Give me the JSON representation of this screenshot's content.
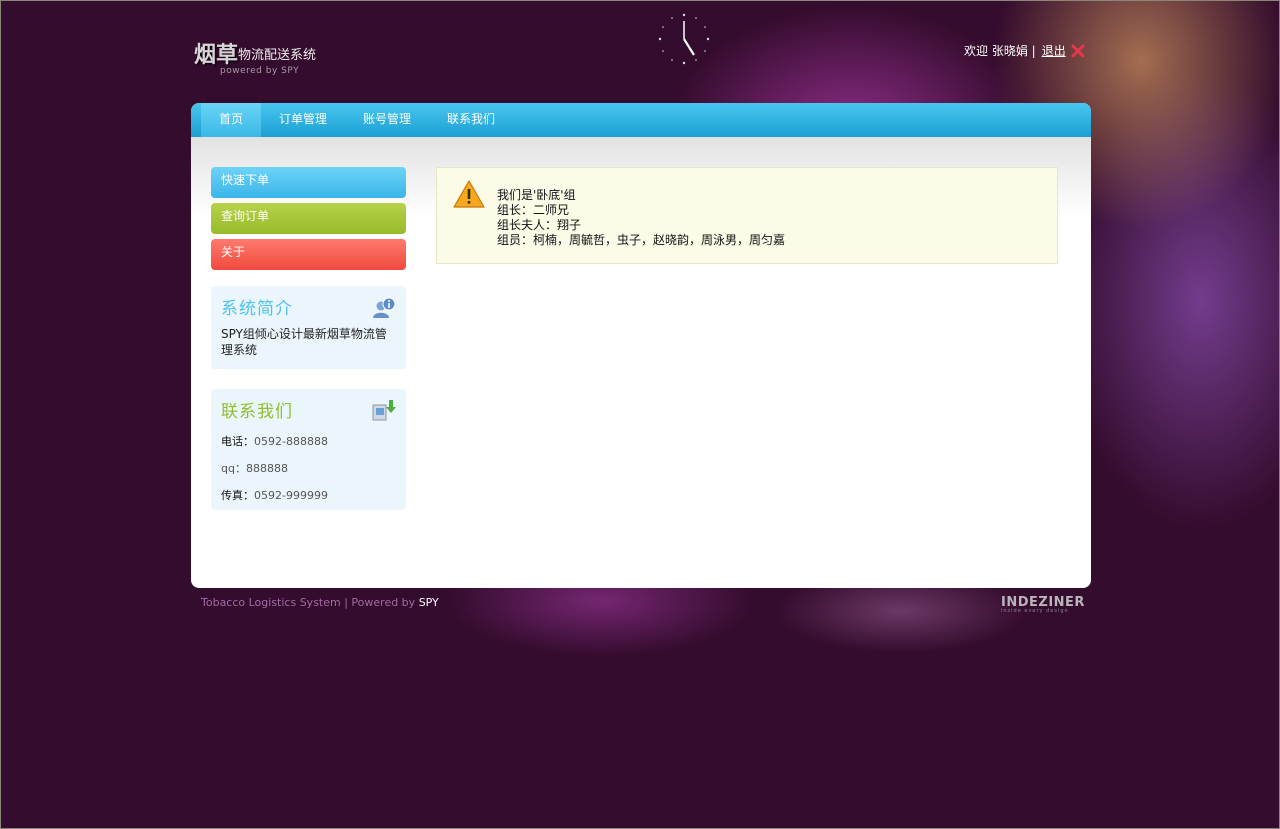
{
  "header": {
    "logo_big": "烟草",
    "logo_small": "物流配送系统",
    "logo_sub": "powered by SPY",
    "welcome": "欢迎 张晓娟 |",
    "logout": "退出"
  },
  "nav": {
    "items": [
      {
        "label": "首页"
      },
      {
        "label": "订单管理"
      },
      {
        "label": "账号管理"
      },
      {
        "label": "联系我们"
      }
    ]
  },
  "sidebar": {
    "buttons": [
      {
        "label": "快速下单"
      },
      {
        "label": "查询订单"
      },
      {
        "label": "关于"
      }
    ],
    "intro": {
      "title": "系统简介",
      "text": "SPY组倾心设计最新烟草物流管理系统"
    },
    "contact": {
      "title": "联系我们",
      "phone_label": "电话：",
      "phone": "0592-888888",
      "qq_label": "qq：",
      "qq": "888888",
      "fax_label": "传真：",
      "fax": "0592-999999"
    }
  },
  "notice": {
    "lines": [
      "我们是'卧底'组",
      "组长：二师兄",
      "组长夫人：翔子",
      "组员：柯楠，周毓哲，虫子，赵晓韵，周泳男，周匀嘉"
    ]
  },
  "footer": {
    "left": "Tobacco Logistics System | Powered by ",
    "powered_by": "SPY",
    "brand": "INDEZINER",
    "brand_sub": "inside every design"
  },
  "colors": {
    "background": "#340c2d",
    "nav": "#1b9fd3",
    "btn_blue": "#3bb5ea",
    "btn_green": "#98bb2c",
    "btn_red": "#f0493d",
    "panel_title_blue": "#4fc2ee",
    "panel_title_green": "#94bd2d"
  }
}
